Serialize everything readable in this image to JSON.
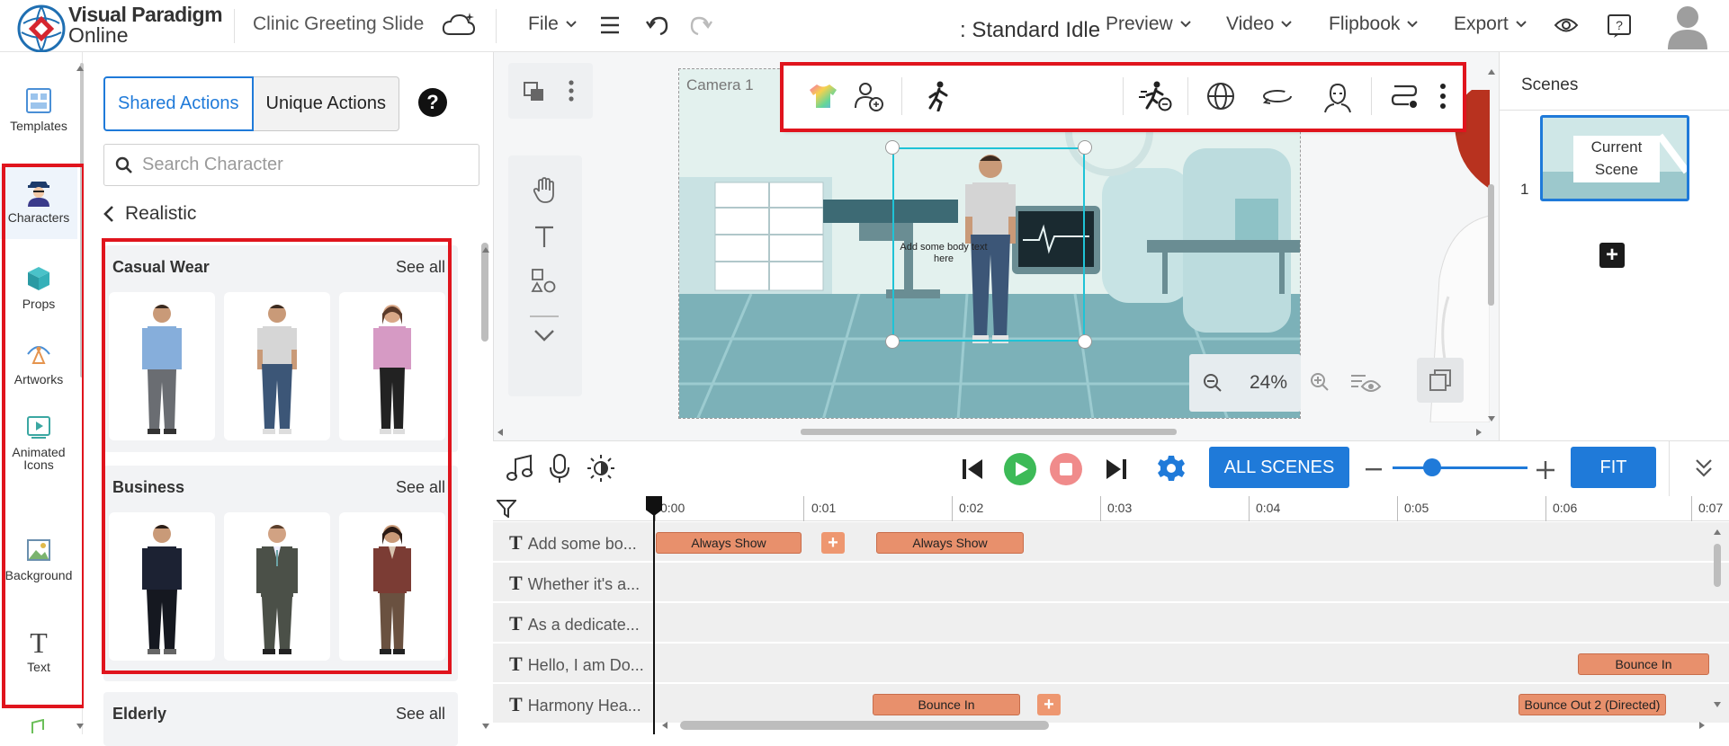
{
  "header": {
    "brand_line1": "Visual Paradigm",
    "brand_line2": "Online",
    "document_title": "Clinic Greeting Slide",
    "menu": {
      "file": "File",
      "preview": "Preview",
      "video": "Video",
      "flipbook": "Flipbook",
      "export": "Export"
    }
  },
  "rail": {
    "items": [
      {
        "label": "Templates",
        "icon": "templates-icon"
      },
      {
        "label": "Characters",
        "icon": "characters-icon"
      },
      {
        "label": "Props",
        "icon": "props-icon"
      },
      {
        "label": "Artworks",
        "icon": "artworks-icon"
      },
      {
        "label": "Animated Icons",
        "icon": "animated-icons-icon"
      },
      {
        "label": "Background",
        "icon": "background-icon"
      },
      {
        "label": "Text",
        "icon": "text-icon"
      }
    ]
  },
  "panel": {
    "tabs": [
      "Shared Actions",
      "Unique Actions"
    ],
    "help": "?",
    "search_placeholder": "Search Character",
    "breadcrumb": "Realistic",
    "categories": [
      {
        "title": "Casual Wear",
        "see_all": "See all"
      },
      {
        "title": "Business",
        "see_all": "See all"
      },
      {
        "title": "Elderly",
        "see_all": "See all"
      }
    ]
  },
  "canvas": {
    "camera_label": "Camera 1",
    "action_label": ": Standard Idle",
    "text_placeholder": "Add some body text here",
    "zoom": "24%"
  },
  "scenes": {
    "title": "Scenes",
    "current_label_line1": "Current",
    "current_label_line2": "Scene",
    "scene_number": "1",
    "add": "+"
  },
  "timeline": {
    "all_scenes": "ALL SCENES",
    "fit": "FIT",
    "ticks": [
      "0:00",
      "0:01",
      "0:02",
      "0:03",
      "0:04",
      "0:05",
      "0:06",
      "0:07"
    ],
    "tracks": [
      {
        "name": "Add some bo...",
        "clips": [
          {
            "label": "Always Show"
          },
          {
            "label": "Always Show"
          }
        ]
      },
      {
        "name": "Whether it's a...",
        "clips": []
      },
      {
        "name": "As a dedicate...",
        "clips": []
      },
      {
        "name": "Hello, I am Do...",
        "clips": [
          {
            "label": "Bounce In"
          }
        ]
      },
      {
        "name": "Harmony Hea...",
        "clips": [
          {
            "label": "Bounce In"
          },
          {
            "label": "Bounce Out 2 (Directed)"
          }
        ]
      }
    ]
  },
  "colors": {
    "accent": "#1f7ad9",
    "highlight": "#e0141d",
    "clip": "#e8906c",
    "play": "#3dba57",
    "stop": "#f07f7f"
  }
}
